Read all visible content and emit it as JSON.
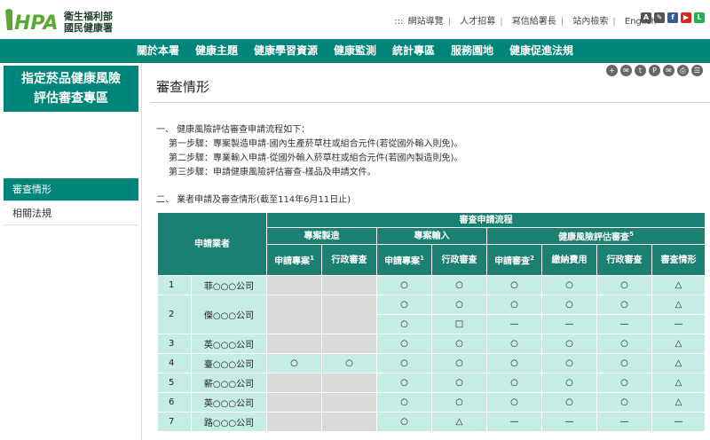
{
  "logo": {
    "mark": "HPA",
    "line1": "衛生福利部",
    "line2": "國民健康署"
  },
  "utility_links": [
    ":::",
    "網站導覽",
    "人才招募",
    "寫信給署長",
    "站內檢索",
    "English"
  ],
  "social_icons": [
    "A",
    "✎",
    "f",
    "▶",
    "L"
  ],
  "colors": {
    "primary": "#00857a",
    "header_cell": "#1b8071",
    "cell": "#c6ece6",
    "gray_cell": "#d9d9d9",
    "logo_green": "#5aaa32"
  },
  "nav": [
    "關於本署",
    "健康主題",
    "健康學習資源",
    "健康監測",
    "統計專區",
    "服務園地",
    "健康促進法規"
  ],
  "sidebar": {
    "title_line1": "指定菸品健康風險",
    "title_line2": "評估審查專區",
    "items": [
      "審查情形",
      "相關法規"
    ]
  },
  "tool_icons": [
    "+",
    "✉",
    "t",
    "P",
    "✉",
    "⎙",
    "☰"
  ],
  "page_title": "審查情形",
  "section1": {
    "heading": "一、 健康風險評估審查申請流程如下：",
    "steps": [
      "第一步驟：專案製造申請-國內生產菸草柱或組合元件(若從國外輸入則免)。",
      "第二步驟：專業輸入申請-從國外輸入菸草柱或組合元件(若國內製造則免)。",
      "第三步驟：申請健康風險評估審查-樣品及申請文件。"
    ]
  },
  "section2_heading": "二、 業者申請及審查情形(截至114年6月11日止)",
  "table": {
    "col_applicant": "申請業者",
    "col_process": "審查申請流程",
    "group_manufacture": "專案製造",
    "group_import": "專案輸入",
    "group_review": "健康風險評估審查",
    "group_review_sup": "5",
    "sub_apply_case": "申請專案",
    "sub_apply_case_sup": "1",
    "sub_admin": "行政審查",
    "sub_apply_review": "申請審查",
    "sub_apply_review_sup": "2",
    "sub_fee": "繳納費用",
    "sub_status": "審查情形",
    "rows": [
      {
        "no": "1",
        "company": "菲○○○公司",
        "m1": "",
        "m2": "",
        "i1": "○",
        "i2": "○",
        "r1": "○",
        "r2": "○",
        "r3": "○",
        "r4": "△"
      },
      {
        "no": "2",
        "company": "傑○○○公司",
        "m1": "",
        "m2": "",
        "i1": "○",
        "i2": "○",
        "r1": "○",
        "r2": "○",
        "r3": "○",
        "r4": "△"
      },
      {
        "no": "",
        "company": "",
        "m1": "",
        "m2": "",
        "i1": "○",
        "i2": "□",
        "r1": "—",
        "r2": "—",
        "r3": "—",
        "r4": "—"
      },
      {
        "no": "3",
        "company": "英○○○公司",
        "m1": "",
        "m2": "",
        "i1": "○",
        "i2": "○",
        "r1": "○",
        "r2": "○",
        "r3": "○",
        "r4": "△"
      },
      {
        "no": "4",
        "company": "臺○○○公司",
        "m1": "○",
        "m2": "○",
        "i1": "○",
        "i2": "○",
        "r1": "○",
        "r2": "○",
        "r3": "○",
        "r4": "△"
      },
      {
        "no": "5",
        "company": "薪○○○公司",
        "m1": "",
        "m2": "",
        "i1": "○",
        "i2": "○",
        "r1": "○",
        "r2": "○",
        "r3": "○",
        "r4": "△"
      },
      {
        "no": "6",
        "company": "英○○○公司",
        "m1": "",
        "m2": "",
        "i1": "○",
        "i2": "○",
        "r1": "○",
        "r2": "○",
        "r3": "○",
        "r4": "△"
      },
      {
        "no": "7",
        "company": "路○○○公司",
        "m1": "",
        "m2": "",
        "i1": "○",
        "i2": "△",
        "r1": "—",
        "r2": "—",
        "r3": "—",
        "r4": "—"
      }
    ]
  }
}
